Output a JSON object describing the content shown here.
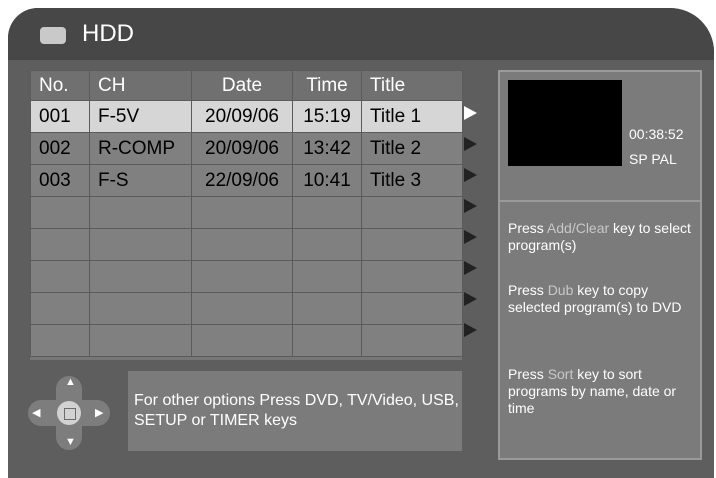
{
  "header": {
    "title": "HDD",
    "icon": "hdd-icon"
  },
  "table": {
    "headers": [
      "No.",
      "CH",
      "Date",
      "Time",
      "Title"
    ],
    "rows": [
      [
        "001",
        "F-5V",
        "20/09/06",
        "15:19",
        "Title 1"
      ],
      [
        "002",
        "R-COMP",
        "20/09/06",
        "13:42",
        "Title 2"
      ],
      [
        "003",
        "F-S",
        "22/09/06",
        "10:41",
        "Title 3"
      ]
    ],
    "empty_rows": 5,
    "selected_index": 0
  },
  "preview": {
    "time": "00:38:52",
    "mode": "SP PAL"
  },
  "help": [
    {
      "pre": "Press ",
      "key": "Add/Clear",
      "post": " key to select program(s)"
    },
    {
      "pre": "Press ",
      "key": "Dub",
      "post": " key to copy selected program(s) to DVD"
    },
    {
      "pre": "Press ",
      "key": "Sort",
      "post": " key to sort programs by name, date or time"
    }
  ],
  "options_text": "For other options Press DVD, TV/Video, USB, SETUP or TIMER keys",
  "colors": {
    "panel": "#5e5e5e",
    "titlebar": "#474747",
    "selected_row": "#d6d6d6",
    "key_highlight": "#c8c8c8"
  }
}
